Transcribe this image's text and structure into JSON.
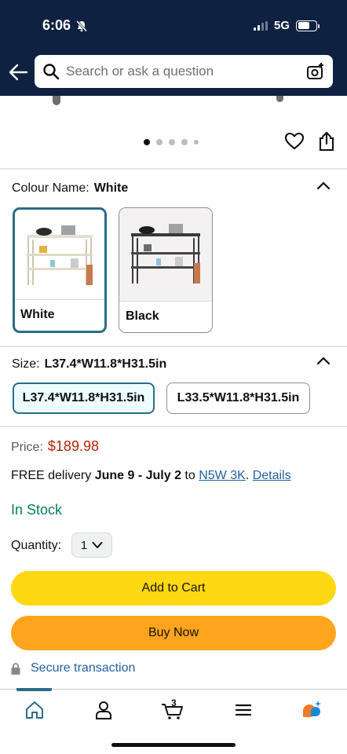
{
  "status": {
    "time": "6:06",
    "network": "5G"
  },
  "header": {
    "search_placeholder": "Search or ask a question"
  },
  "gallery": {
    "page_count": 5,
    "active_index": 0
  },
  "colour": {
    "label": "Colour Name:",
    "selected": "White",
    "options": [
      {
        "name": "White"
      },
      {
        "name": "Black"
      }
    ]
  },
  "size": {
    "label": "Size:",
    "selected": "L37.4*W11.8*H31.5in",
    "options": [
      "L37.4*W11.8*H31.5in",
      "L33.5*W11.8*H31.5in"
    ]
  },
  "price": {
    "label": "Price:",
    "value": "$189.98"
  },
  "delivery": {
    "prefix": "FREE delivery",
    "dates": "June 9 - July 2",
    "to": "to",
    "postal": "N5W 3K",
    "sep": ".",
    "details": "Details"
  },
  "stock": "In Stock",
  "quantity": {
    "label": "Quantity:",
    "value": "1"
  },
  "buttons": {
    "add_to_cart": "Add to Cart",
    "buy_now": "Buy Now"
  },
  "secure": "Secure transaction",
  "nav": {
    "cart_count": "3"
  },
  "colors": {
    "header_bg": "#0f2140",
    "add_to_cart": "#ffd814",
    "buy_now": "#ffa41c",
    "price": "#b12704",
    "in_stock": "#067d62",
    "link": "#2162a1",
    "selected_border": "#2a6d87"
  }
}
